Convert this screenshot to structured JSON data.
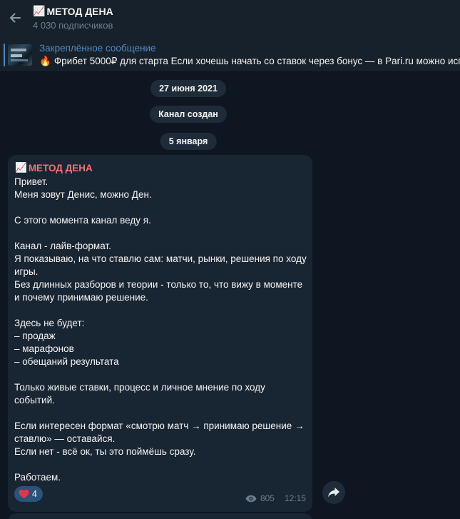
{
  "header": {
    "title_emoji": "📈",
    "title": "МЕТОД ДЕНА",
    "subscribers": "4 030 подписчиков"
  },
  "pinned": {
    "title": "Закреплённое сообщение",
    "emoji": "🔥",
    "text": "Фрибет 5000₽ для старта  Если хочешь начать со ставок через бонус — в Pari.ru можно исп"
  },
  "service": {
    "date1": "27 июня 2021",
    "created": "Канал создан",
    "date2": "5 января"
  },
  "message": {
    "author_emoji": "📈",
    "author": "МЕТОД ДЕНА",
    "lines": [
      "Привет.",
      "Меня зовут Денис, можно Ден.",
      "",
      "С этого момента канал веду я.",
      "",
      "Канал - лайв-формат.",
      "Я показываю, на что ставлю сам: матчи, рынки, решения по ходу",
      "игры.",
      "Без длинных разборов и теории - только то, что вижу в моменте",
      "и почему принимаю решение.",
      "",
      "Здесь не будет:",
      "– продаж",
      "– марафонов",
      "– обещаний результата",
      "",
      "Только живые ставки, процесс и личное мнение по ходу",
      "событий.",
      "",
      "Если интересен формат «смотрю матч → принимаю решение →",
      "ставлю» — оставайся.",
      "Если нет - всё ок, ты это поймёшь сразу.",
      "",
      "Работаем."
    ],
    "reaction_emoji": "❤️",
    "reaction_count": "4",
    "views": "805",
    "time": "12:15"
  },
  "icons": {
    "back": "arrow-left-icon",
    "views": "eye-icon",
    "share": "share-arrow-icon",
    "heart": "heart-icon"
  },
  "colors": {
    "background": "#0e1621",
    "header": "#17212b",
    "bubble": "#182533",
    "accent": "#5288c1",
    "author": "#f07670",
    "reaction": "#2b5278"
  }
}
